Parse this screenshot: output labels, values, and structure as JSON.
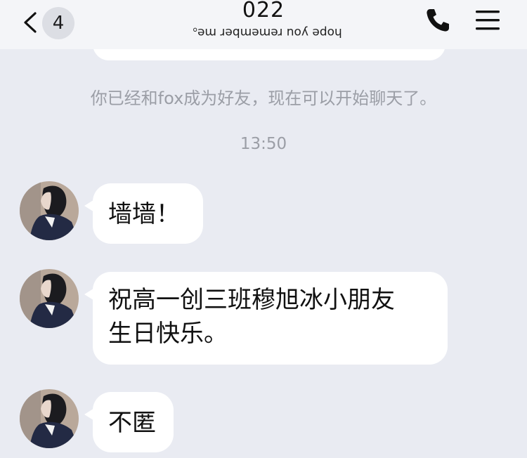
{
  "header": {
    "unread_count": "4",
    "title": "022",
    "subtitle": "hope you remember me。",
    "back_icon": "chevron-left-icon",
    "call_icon": "phone-icon",
    "menu_icon": "menu-icon"
  },
  "system": {
    "friend_notice": "你已经和fox成为好友，现在可以开始聊天了。",
    "timestamp": "13:50"
  },
  "messages": [
    {
      "sender": "fox",
      "text": "墙墙！"
    },
    {
      "sender": "fox",
      "line1": "祝高一创三班穆旭冰小朋友",
      "line2": "生日快乐。"
    },
    {
      "sender": "fox",
      "text": "不匿"
    }
  ],
  "colors": {
    "background": "#e9ebf2",
    "header": "#f4f5f8",
    "bubble": "#ffffff",
    "muted_text": "#9b9ea6"
  }
}
